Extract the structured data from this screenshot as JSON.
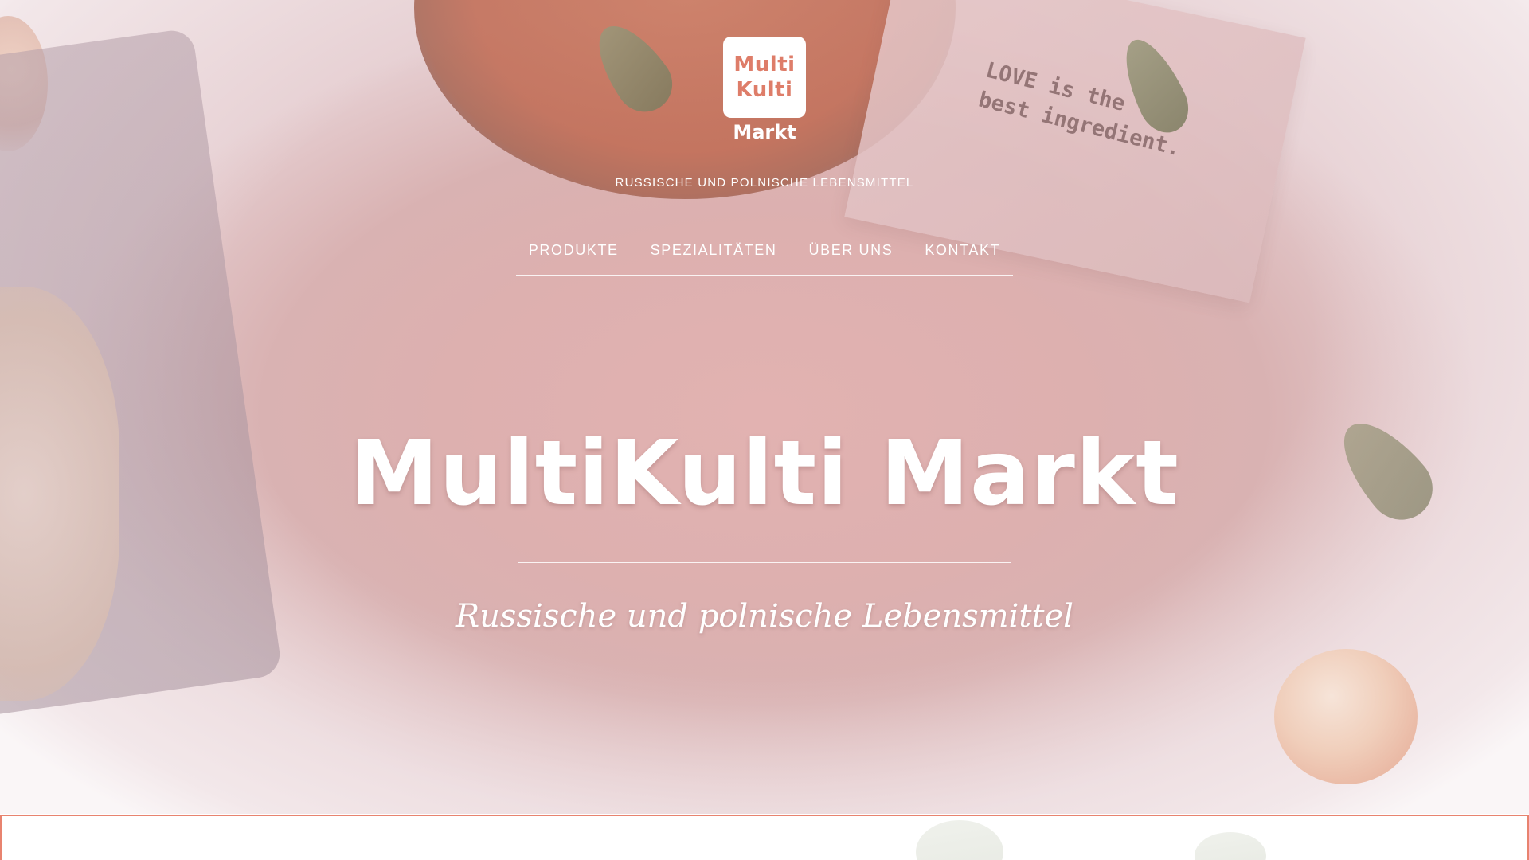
{
  "logo": {
    "line1": "Multi",
    "line2": "Kulti",
    "line3": "Markt"
  },
  "tagline": "RUSSISCHE UND POLNISCHE LEBENSMITTEL",
  "nav": {
    "items": [
      {
        "label": "PRODUKTE"
      },
      {
        "label": "SPEZIALITÄTEN"
      },
      {
        "label": "ÜBER UNS"
      },
      {
        "label": "KONTAKT"
      }
    ]
  },
  "hero": {
    "title": "MultiKulti Markt",
    "subtitle": "Russische und polnische Lebensmittel"
  },
  "decor": {
    "napkin_line1": "LOVE is the",
    "napkin_line2": "best ingredient."
  },
  "colors": {
    "accent": "#de7d69",
    "border_accent": "#e8836f",
    "hero_bg": "#ddb0af",
    "text_light": "#ffffff"
  }
}
